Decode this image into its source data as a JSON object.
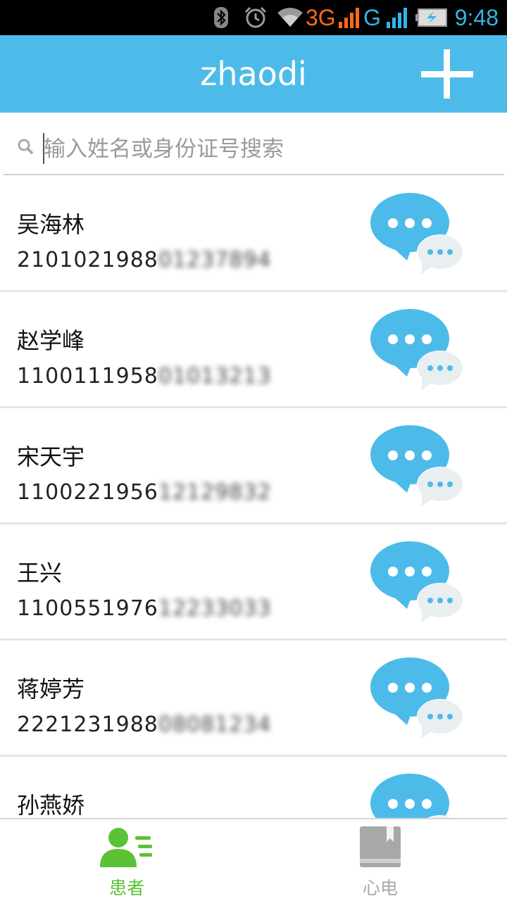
{
  "status_bar": {
    "network_3g": "3G",
    "network_g": "G",
    "time": "9:48",
    "icons": [
      "bluetooth-icon",
      "alarm-icon",
      "wifi-icon",
      "signal-icon",
      "battery-icon"
    ]
  },
  "header": {
    "title": "zhaodi",
    "add_icon": "plus-icon"
  },
  "search": {
    "placeholder": "输入姓名或身份证号搜索",
    "value": "",
    "icon": "search-icon"
  },
  "patients": [
    {
      "name": "吴海林",
      "id_visible": "2101021988",
      "id_blurred": "012378",
      "id_tail": "94"
    },
    {
      "name": "赵学峰",
      "id_visible": "1100111958",
      "id_blurred": "010132",
      "id_tail": "13"
    },
    {
      "name": "宋天宇",
      "id_visible": "1100221956",
      "id_blurred": "121298",
      "id_tail": "32"
    },
    {
      "name": "王兴",
      "id_visible": "1100551976",
      "id_blurred": "122330",
      "id_tail": "33"
    },
    {
      "name": "蒋婷芳",
      "id_visible": "2221231988",
      "id_blurred": "080812",
      "id_tail": "34"
    },
    {
      "name": "孙燕娇",
      "id_visible": "",
      "id_blurred": "",
      "id_tail": ""
    }
  ],
  "bottom_nav": {
    "tabs": [
      {
        "label": "患者",
        "icon": "patient-icon",
        "active": true
      },
      {
        "label": "心电",
        "icon": "book-icon",
        "active": false
      }
    ]
  },
  "colors": {
    "title_bar": "#4dbbea",
    "chat_icon": "#4dbbea",
    "active_tab": "#5ac234",
    "inactive_tab": "#a8a8a8"
  }
}
